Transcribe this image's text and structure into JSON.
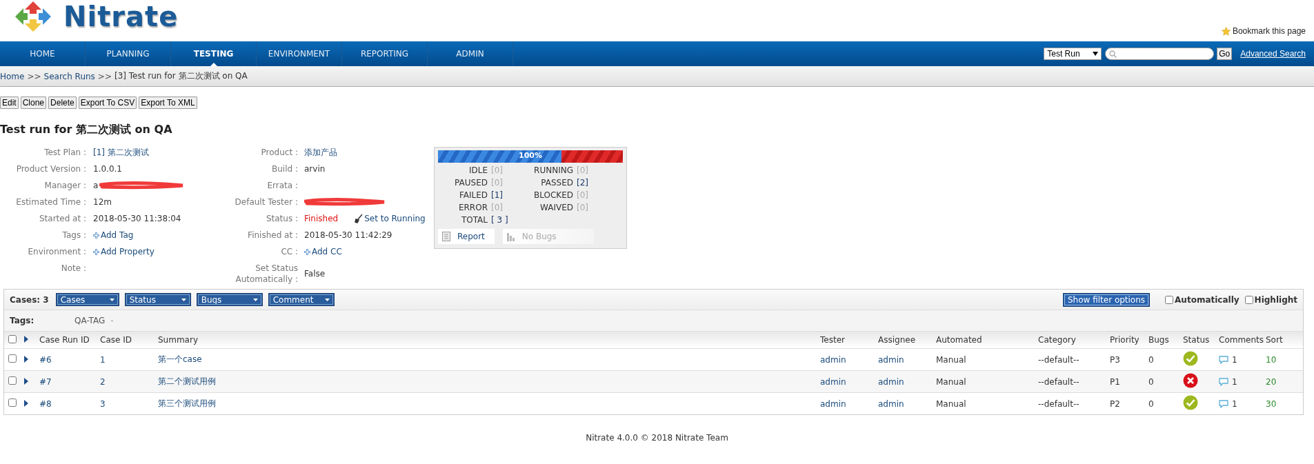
{
  "header": {
    "logo_text": "Nitrate",
    "bookmark": "Bookmark this page"
  },
  "nav": {
    "items": [
      {
        "label": "HOME",
        "selected": false
      },
      {
        "label": "PLANNING",
        "selected": false
      },
      {
        "label": "TESTING",
        "selected": true
      },
      {
        "label": "ENVIRONMENT",
        "selected": false
      },
      {
        "label": "REPORTING",
        "selected": false
      },
      {
        "label": "ADMIN",
        "selected": false
      }
    ],
    "search_type": "Test Run",
    "go": "Go",
    "advanced_search": "Advanced Search"
  },
  "breadcrumb": [
    {
      "label": "Home",
      "kind": "link"
    },
    {
      "label": ">>",
      "kind": "separator"
    },
    {
      "label": "Search Runs",
      "kind": "link"
    },
    {
      "label": ">>",
      "kind": "separator"
    },
    {
      "label": "[3] Test run for 第二次测试 on QA",
      "kind": "current"
    }
  ],
  "actions": [
    "Edit",
    "Clone",
    "Delete",
    "Export To CSV",
    "Export To XML"
  ],
  "title": "Test run for 第二次测试 on QA",
  "details_left": [
    {
      "label": "Test Plan :",
      "kind": "link",
      "value": "[1] 第二次测试"
    },
    {
      "label": "Product Version :",
      "kind": "text",
      "value": "1.0.0.1"
    },
    {
      "label": "Manager :",
      "kind": "redacted",
      "value": "a"
    },
    {
      "label": "Estimated Time :",
      "kind": "text",
      "value": "12m"
    },
    {
      "label": "Started at :",
      "kind": "text",
      "value": "2018-05-30 11:38:04"
    },
    {
      "label": "Tags :",
      "kind": "add",
      "value": "Add Tag"
    },
    {
      "label": "Environment :",
      "kind": "add",
      "value": "Add Property"
    },
    {
      "label": "Note :",
      "kind": "empty"
    }
  ],
  "details_right": [
    {
      "label": "Product :",
      "kind": "link",
      "value": "添加产品"
    },
    {
      "label": "Build :",
      "kind": "text",
      "value": "arvin"
    },
    {
      "label": "Errata :",
      "kind": "empty"
    },
    {
      "label": "Default Tester :",
      "kind": "redacted"
    },
    {
      "label": "Status :",
      "kind": "status",
      "value": "Finished",
      "action": "Set to Running"
    },
    {
      "label": "Finished at :",
      "kind": "text",
      "value": "2018-05-30 11:42:29"
    },
    {
      "label": "CC :",
      "kind": "add",
      "value": "Add CC"
    },
    {
      "label": "Set Status Automatically :",
      "kind": "text",
      "value": "False"
    }
  ],
  "stats": {
    "progress": {
      "label": "100%",
      "level": 0.667
    },
    "counts": [
      {
        "label": "IDLE",
        "value": "[0]",
        "highlighted": false
      },
      {
        "label": "RUNNING",
        "value": "[0]",
        "highlighted": false
      },
      {
        "label": "PAUSED",
        "value": "[0]",
        "highlighted": false
      },
      {
        "label": "PASSED",
        "value": "[2]",
        "highlighted": true
      },
      {
        "label": "FAILED",
        "value": "[1]",
        "highlighted": true
      },
      {
        "label": "BLOCKED",
        "value": "[0]",
        "highlighted": false
      },
      {
        "label": "ERROR",
        "value": "[0]",
        "highlighted": false
      },
      {
        "label": "WAIVED",
        "value": "[0]",
        "highlighted": false
      },
      {
        "label": "TOTAL",
        "value": "[ 3 ]",
        "highlighted": true
      }
    ],
    "report": {
      "label": "Report",
      "disabled": false
    },
    "bugs": {
      "label": "No Bugs",
      "disabled": true
    }
  },
  "cases": {
    "count_label": "Cases: 3",
    "menus": [
      "Cases",
      "Status",
      "Bugs",
      "Comment"
    ],
    "filter_button": "Show filter options",
    "options": [
      {
        "label": "Automatically",
        "checked": false
      },
      {
        "label": "Highlight",
        "checked": false
      }
    ],
    "tags_label": "Tags:",
    "tags": [
      "QA-TAG",
      "-"
    ],
    "select_all": false,
    "columns": [
      "Case Run ID",
      "Case ID",
      "Summary",
      "Tester",
      "Assignee",
      "Automated",
      "Category",
      "Priority",
      "Bugs",
      "Status",
      "Comments",
      "Sort"
    ],
    "rows": [
      {
        "checked": false,
        "case_run_id": "#6",
        "case_id": "1",
        "summary": "第一个case",
        "tester": "admin",
        "assignee": "admin",
        "automated": "Manual",
        "category": "--default--",
        "priority": "P3",
        "bugs": "0",
        "passed": true,
        "comments": "1",
        "sort": "10"
      },
      {
        "checked": false,
        "case_run_id": "#7",
        "case_id": "2",
        "summary": "第二个测试用例",
        "tester": "admin",
        "assignee": "admin",
        "automated": "Manual",
        "category": "--default--",
        "priority": "P1",
        "bugs": "0",
        "passed": false,
        "comments": "1",
        "sort": "20"
      },
      {
        "checked": false,
        "case_run_id": "#8",
        "case_id": "3",
        "summary": "第三个测试用例",
        "tester": "admin",
        "assignee": "admin",
        "automated": "Manual",
        "category": "--default--",
        "priority": "P2",
        "bugs": "0",
        "passed": true,
        "comments": "1",
        "sort": "30"
      }
    ]
  },
  "footer": "Nitrate 4.0.0 © 2018 Nitrate Team"
}
